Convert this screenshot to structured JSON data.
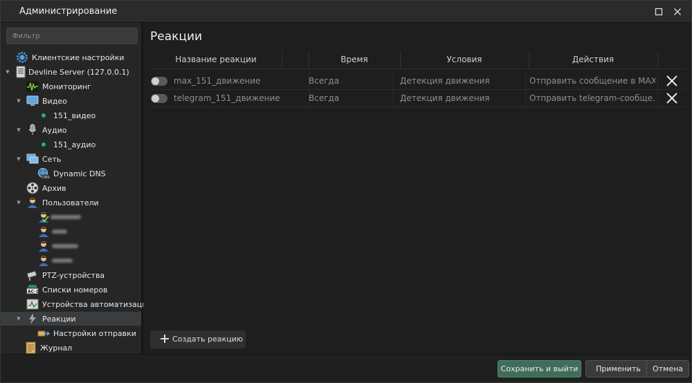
{
  "window": {
    "title": "Администрирование"
  },
  "sidebar": {
    "filter_placeholder": "Фильтр",
    "tree": [
      {
        "label": "Клиентские настройки",
        "icon": "gear-icon"
      },
      {
        "label": "Devline Server (127.0.0.1)",
        "icon": "server-icon",
        "expanded": true
      },
      {
        "label": "Мониторинг",
        "icon": "monitoring-icon"
      },
      {
        "label": "Видео",
        "icon": "monitor-icon",
        "expanded": true
      },
      {
        "label": "151_видео",
        "status": "online"
      },
      {
        "label": "Аудио",
        "icon": "microphone-icon",
        "expanded": true
      },
      {
        "label": "151_аудио",
        "status": "online"
      },
      {
        "label": "Сеть",
        "icon": "network-icon",
        "expanded": true
      },
      {
        "label": "Dynamic DNS",
        "icon": "globe-dns-icon"
      },
      {
        "label": "Архив",
        "icon": "film-reel-icon"
      },
      {
        "label": "Пользователи",
        "icon": "users-icon",
        "expanded": true
      },
      {
        "label": "PTZ-устройства",
        "icon": "ptz-camera-icon"
      },
      {
        "label": "Списки номеров",
        "icon": "license-plate-icon"
      },
      {
        "label": "Устройства автоматизации",
        "icon": "automation-icon"
      },
      {
        "label": "Реакции",
        "icon": "lightning-icon",
        "expanded": true,
        "selected": true
      },
      {
        "label": "Настройки отправки",
        "icon": "send-settings-icon"
      },
      {
        "label": "Журнал",
        "icon": "journal-icon"
      }
    ]
  },
  "main": {
    "title": "Реакции",
    "columns": [
      "Название реакции",
      "Время",
      "Условия",
      "Действия"
    ],
    "rows": [
      {
        "name": "max_151_движение",
        "time": "Всегда",
        "condition": "Детекция движения",
        "action": "Отправить сообщение в MAX",
        "enabled": false
      },
      {
        "name": "telegram_151_движение",
        "time": "Всегда",
        "condition": "Детекция движения",
        "action": "Отправить telegram-сообще...",
        "enabled": false
      }
    ],
    "create_label": "Создать реакцию"
  },
  "footer": {
    "save_exit": "Сохранить и выйти",
    "apply": "Применить",
    "cancel": "Отмена"
  },
  "colors": {
    "accent_green": "#3f6d5a",
    "status_online": "#1fb36a"
  }
}
